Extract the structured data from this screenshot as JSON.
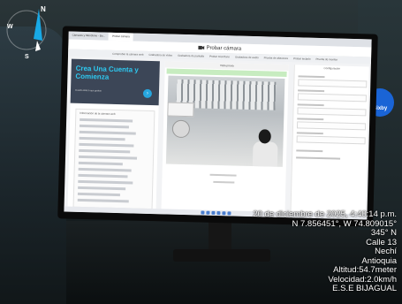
{
  "browser": {
    "tabs": [
      "Cámaras y Micrófono - Bo...",
      "Probar cámara",
      ""
    ],
    "page_title": "Probar cámara",
    "nav_items": [
      "Comprobar la cámara web",
      "Grabadora de vídeo",
      "Grabadora de pantalla",
      "Probar micrófono",
      "Grabadora de audio",
      "Prueba de altavoces",
      "Probar teclado",
      "Prueba de monitor"
    ]
  },
  "promo": {
    "title": "Crea Una Cuenta y Comienza",
    "subtitle": "Guarda todo lo que grabas"
  },
  "panels": {
    "center_heading": "Vista previa",
    "info_heading": "Información de la cámara web",
    "right_heading": "Configuración"
  },
  "overlay": {
    "datetime": "20 de diciembre de 2025, 4:40:14 p.m.",
    "coords": "N 7.856451°, W 74.809015°",
    "heading": "345° N",
    "street": "Calle 13",
    "city": "Nechí",
    "region": "Antioquia",
    "altitude": "Altitud:54.7meter",
    "speed": "Velocidad:2.0km/h",
    "org": "E.S.E BIJAGUAL"
  },
  "compass": {
    "letters": [
      "N",
      "W",
      "S"
    ]
  },
  "badge": {
    "label": "Bixby"
  },
  "colors": {
    "promo_bg": "#3c4657",
    "promo_title": "#2ec8f0",
    "green_bar": "#c7ecc0",
    "badge": "#1a64d6"
  }
}
